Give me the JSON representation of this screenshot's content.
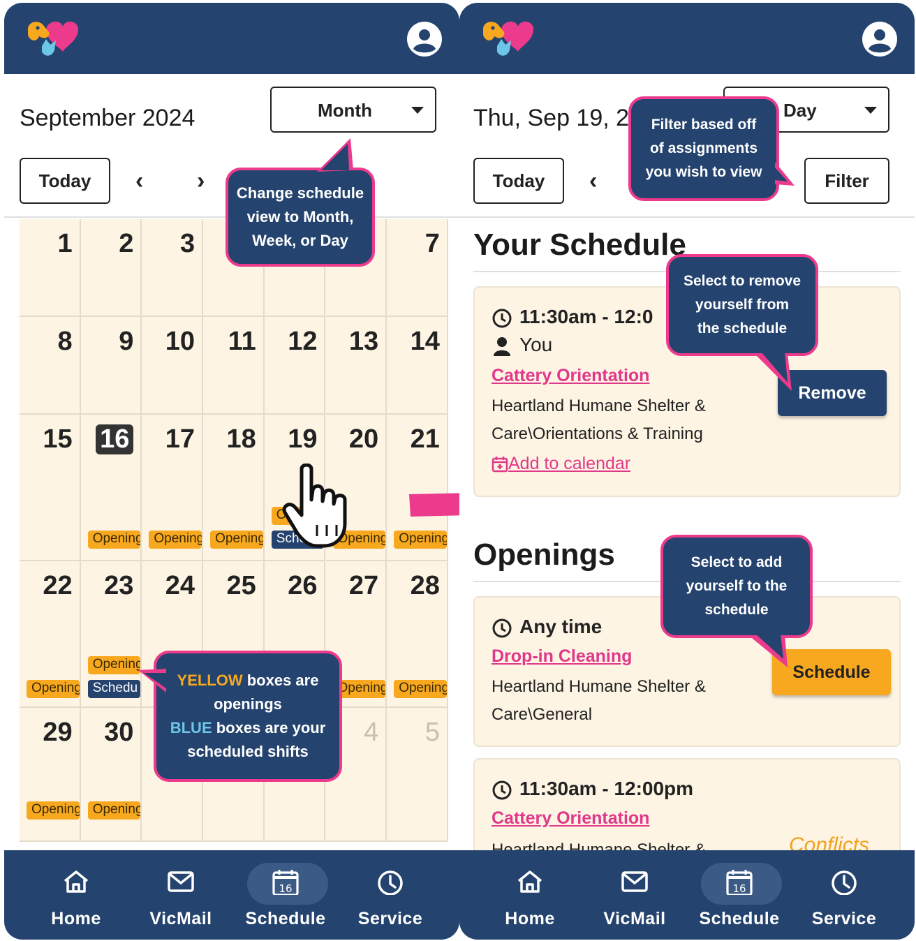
{
  "colors": {
    "navy": "#24436e",
    "pink": "#ec3a8c",
    "yellow": "#f7a81f",
    "cream": "#fdf4e3",
    "blue_text": "#6cc6e8"
  },
  "left": {
    "title": "September 2024",
    "view_select": "Month",
    "today_label": "Today",
    "prev_icon": "‹",
    "next_icon": "›",
    "weeks": [
      [
        "1",
        "2",
        "3",
        "",
        "",
        "",
        "7"
      ],
      [
        "8",
        "9",
        "10",
        "11",
        "12",
        "13",
        "14"
      ],
      [
        "15",
        "16",
        "17",
        "18",
        "19",
        "20",
        "21"
      ],
      [
        "22",
        "23",
        "24",
        "25",
        "26",
        "27",
        "28"
      ],
      [
        "29",
        "30",
        "",
        "",
        "",
        "4",
        "5"
      ]
    ],
    "today_day": "16",
    "chips": {
      "opening": "Opening",
      "scheduled": "Schedu"
    },
    "callout_view": [
      "Change schedule",
      "view to Month,",
      "Week, or Day"
    ],
    "callout_legend": {
      "yellow_word": "YELLOW",
      "yellow_rest": " boxes are",
      "line2": "openings",
      "blue_word": "BLUE",
      "blue_rest": " boxes are your",
      "line4": "scheduled shifts"
    }
  },
  "right": {
    "title": "Thu, Sep 19, 20",
    "view_select": "Day",
    "today_label": "Today",
    "prev_icon": "‹",
    "filter_label": "Filter",
    "your_schedule_title": "Your Schedule",
    "openings_title": "Openings",
    "shift1": {
      "time": "11:30am - 12:0",
      "person": "You",
      "name": "Cattery Orientation",
      "location_line1": "Heartland Humane Shelter &",
      "location_line2": "Care\\Orientations & Training",
      "add_calendar": "Add to calendar",
      "remove_label": "Remove"
    },
    "opening1": {
      "time": "Any time",
      "name": "Drop-in Cleaning",
      "location_line1": "Heartland Humane Shelter &",
      "location_line2": "Care\\General",
      "schedule_label": "Schedule"
    },
    "opening2": {
      "time": "11:30am - 12:00pm",
      "name": "Cattery Orientation",
      "location_line1": "Heartland Humane Shelter &",
      "conflicts": "Conflicts"
    },
    "callout_filter": [
      "Filter based off",
      "of assignments",
      "you wish to view"
    ],
    "callout_remove": [
      "Select to remove",
      "yourself from",
      "the schedule"
    ],
    "callout_add": [
      "Select to add",
      "yourself to the",
      "schedule"
    ]
  },
  "nav": [
    {
      "label": "Home",
      "icon": "home-icon"
    },
    {
      "label": "VicMail",
      "icon": "mail-icon"
    },
    {
      "label": "Schedule",
      "icon": "calendar-icon",
      "badge": "16"
    },
    {
      "label": "Service",
      "icon": "clock-icon"
    }
  ]
}
